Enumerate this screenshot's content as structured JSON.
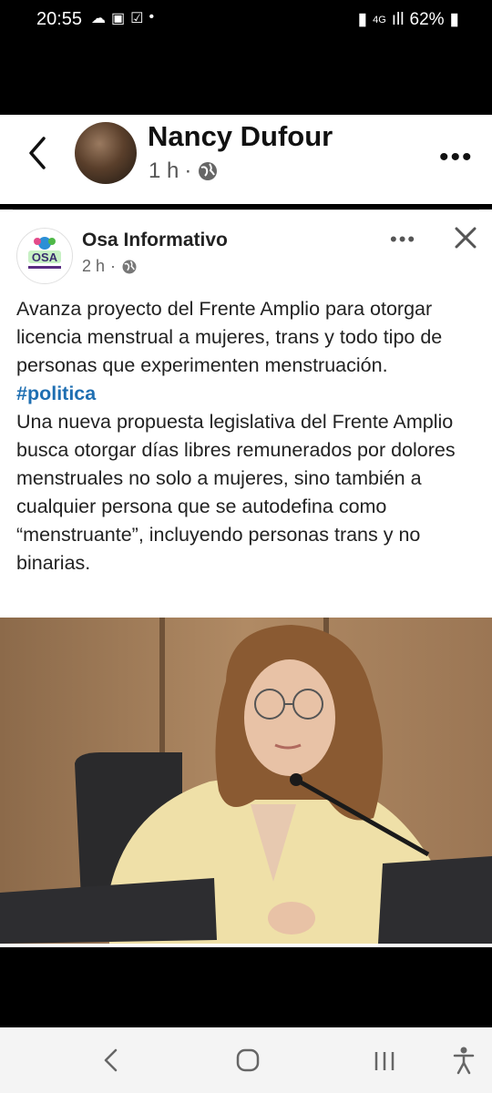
{
  "status_bar": {
    "time": "20:55",
    "network": "4G",
    "battery": "62%"
  },
  "header": {
    "author": "Nancy Dufour",
    "time": "1 h",
    "separator": "·"
  },
  "shared_post": {
    "page_name": "Osa Informativo",
    "time": "2 h",
    "separator": "·",
    "logo_text": "OSA",
    "headline": "Avanza proyecto del Frente Amplio para otorgar licencia menstrual a mujeres, trans y todo tipo de personas que experimenten menstruación.",
    "hashtag": "#politica",
    "body": "Una nueva propuesta legislativa del Frente Amplio busca otorgar días libres remunerados por dolores menstruales no solo a mujeres, sino también a cualquier  persona que se autodefina como “menstruante”, incluyendo personas trans y no binarias."
  },
  "colors": {
    "hashtag": "#1f6fb2",
    "background": "#ffffff"
  }
}
